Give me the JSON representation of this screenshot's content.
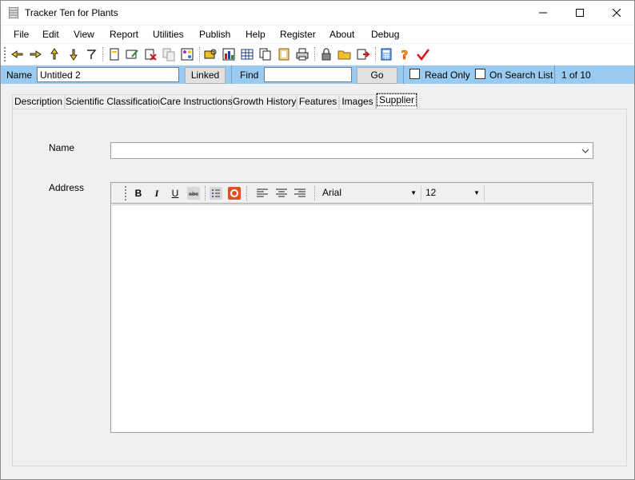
{
  "window": {
    "title": "Tracker Ten for Plants"
  },
  "menu": [
    "File",
    "Edit",
    "View",
    "Report",
    "Utilities",
    "Publish",
    "Help",
    "Register",
    "About",
    "Debug"
  ],
  "toolbar": {
    "icons": [
      "first-record-icon",
      "next-record-icon",
      "previous-record-icon",
      "last-record-icon",
      "jump-record-icon",
      "new-record-icon",
      "edit-record-icon",
      "delete-record-icon",
      "copy-record-icon",
      "sort-records-icon",
      "search-icon",
      "chart-icon",
      "table-view-icon",
      "pages-icon",
      "filmstrip-icon",
      "print-icon",
      "lock-icon",
      "open-folder-icon",
      "export-icon",
      "calculator-icon",
      "help-icon",
      "check-icon"
    ]
  },
  "navbar": {
    "name_label": "Name",
    "name_value": "Untitled 2",
    "linked_label": "Linked",
    "find_label": "Find",
    "find_value": "",
    "go_label": "Go",
    "read_only_label": "Read Only",
    "on_search_list_label": "On Search List",
    "record_counter": "1 of 10"
  },
  "tabs": [
    "Description",
    "Scientific Classification",
    "Care Instructions",
    "Growth History",
    "Features",
    "Images",
    "Supplier"
  ],
  "active_tab": "Supplier",
  "supplier": {
    "name_label": "Name",
    "name_value": "",
    "address_label": "Address",
    "address_value": ""
  },
  "editor_toolbar": {
    "bold": "B",
    "italic": "I",
    "underline": "U",
    "font_name": "Arial",
    "font_size": "12"
  }
}
